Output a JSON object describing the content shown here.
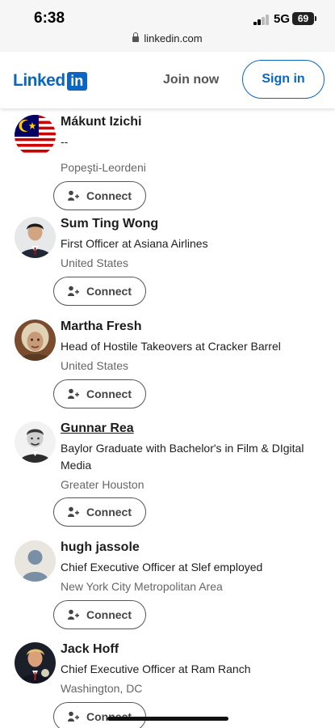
{
  "status_bar": {
    "time": "6:38",
    "network": "5G",
    "battery": "69"
  },
  "browser": {
    "url": "linkedin.com"
  },
  "header": {
    "logo_text": "Linked",
    "logo_box": "in",
    "join_label": "Join now",
    "signin_label": "Sign in",
    "accent_color": "#0a66c2"
  },
  "people": [
    {
      "name": "Mákunt Izichi",
      "headline": "--",
      "location": "Popeşti-Leordeni",
      "connect_label": "Connect",
      "avatar_icon": "malaysia-flag-avatar"
    },
    {
      "name": "Sum Ting Wong",
      "headline": "First Officer at Asiana Airlines",
      "location": "United States",
      "connect_label": "Connect",
      "avatar_icon": "photo-avatar"
    },
    {
      "name": "Martha Fresh",
      "headline": "Head of Hostile Takeovers at Cracker Barrel",
      "location": "United States",
      "connect_label": "Connect",
      "avatar_icon": "photo-avatar"
    },
    {
      "name": "Gunnar Rea",
      "headline": "Baylor Graduate with Bachelor's in Film & DIgital Media",
      "location": "Greater Houston",
      "connect_label": "Connect",
      "avatar_icon": "photo-avatar"
    },
    {
      "name": "hugh jassole",
      "headline": "Chief Executive Officer at Slef employed",
      "location": "New York City Metropolitan Area",
      "connect_label": "Connect",
      "avatar_icon": "default-person-avatar"
    },
    {
      "name": "Jack Hoff",
      "headline": "Chief Executive Officer at Ram Ranch",
      "location": "Washington, DC",
      "connect_label": "Connect",
      "avatar_icon": "photo-avatar"
    }
  ]
}
